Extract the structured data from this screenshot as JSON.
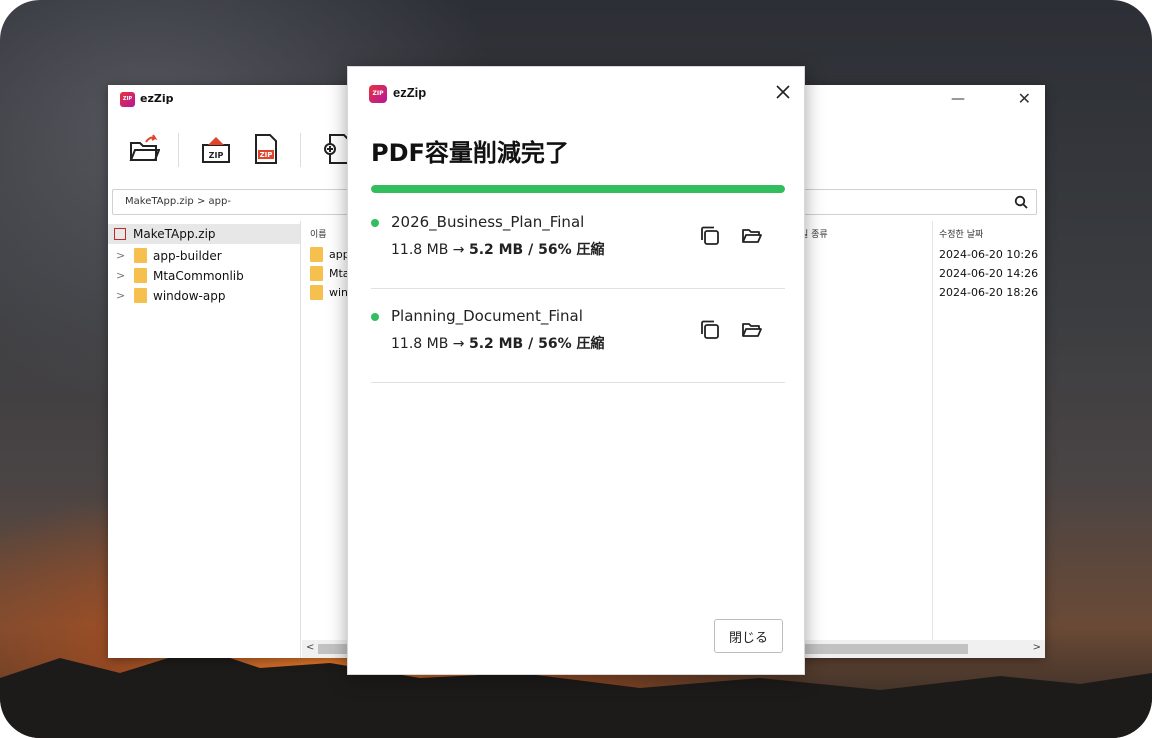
{
  "background_app": {
    "title": "ezZip",
    "logo_text": "ZIP",
    "path": "MakeTApp.zip > app-",
    "tree": {
      "root": "MakeTApp.zip",
      "items": [
        {
          "label": "app-builder"
        },
        {
          "label": "MtaCommonlib"
        },
        {
          "label": "window-app"
        }
      ]
    },
    "list": {
      "columns": {
        "name": "이름",
        "type": "일 종류",
        "modified": "수정한 날짜"
      },
      "rows": [
        {
          "name": "app",
          "modified": "2024-06-20  10:26"
        },
        {
          "name": "Mta",
          "modified": "2024-06-20  14:26"
        },
        {
          "name": "win",
          "modified": "2024-06-20  18:26"
        }
      ]
    },
    "toolbar": {
      "zip_label": "ZIP",
      "zip2_label": "ZIP"
    },
    "window_controls": {
      "minimize": "—",
      "close": "✕"
    },
    "scroll": {
      "left": "<",
      "right": ">"
    }
  },
  "dialog": {
    "app_name": "ezZip",
    "logo_text": "ZIP",
    "title": "PDF容量削減完了",
    "progress_percent": 100,
    "results": [
      {
        "file_name": "2026_Business_Plan_Final",
        "original_size": "11.8 MB",
        "arrow": "→",
        "result_text": "5.2 MB / 56% 圧縮"
      },
      {
        "file_name": "Planning_Document_Final",
        "original_size": "11.8 MB",
        "arrow": "→",
        "result_text": "5.2 MB / 56% 圧縮"
      }
    ],
    "close_button_label": "閉じる"
  },
  "colors": {
    "accent_green": "#32bd5e",
    "logo_gradient_start": "#e8323a",
    "logo_gradient_end": "#b5179e",
    "folder": "#f6c04e"
  },
  "icons": {
    "dialog_close": "close-icon",
    "copy": "copy-icon",
    "open_folder": "open-folder-icon",
    "search": "search-icon"
  }
}
